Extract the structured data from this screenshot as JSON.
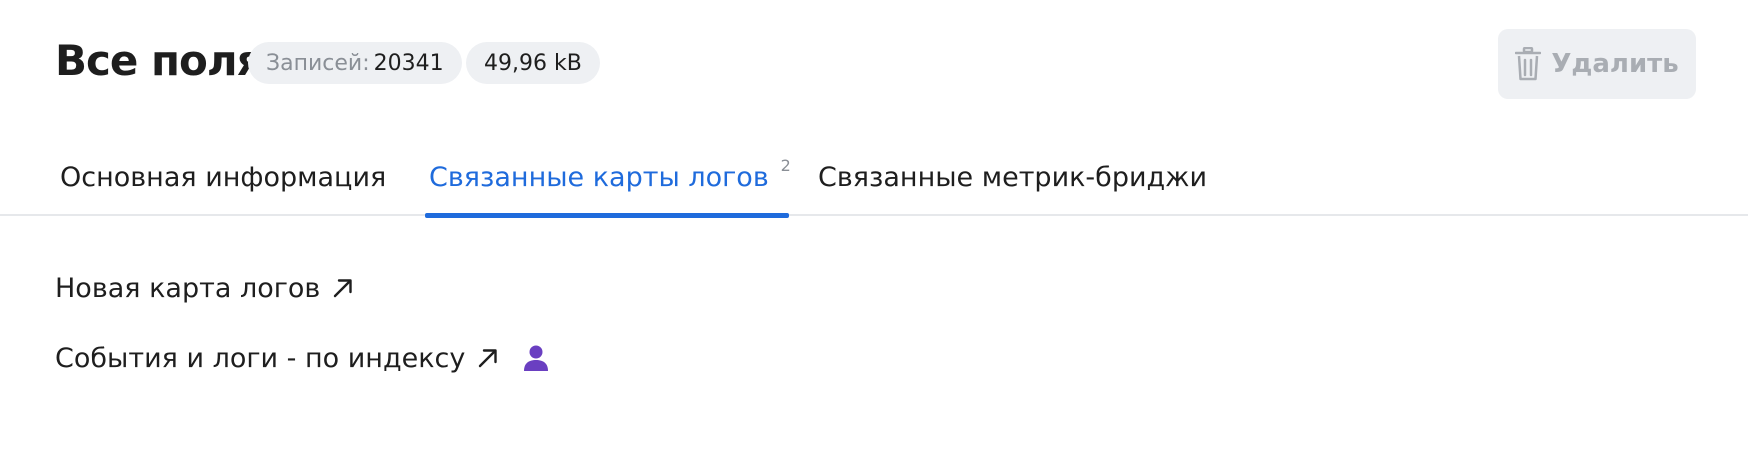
{
  "header": {
    "title": "Все поля",
    "records_label": "Записей:",
    "records_value": "20341",
    "size_value": "49,96 kB",
    "delete_label": "Удалить"
  },
  "tabs": [
    {
      "label": "Основная информация",
      "active": false
    },
    {
      "label": "Связанные карты логов",
      "active": true,
      "counter": "2"
    },
    {
      "label": "Связанные метрик-бриджи",
      "active": false
    }
  ],
  "links": [
    {
      "label": "Новая карта логов",
      "icon": "external-arrow-icon"
    },
    {
      "label": "События и логи - по индексу",
      "icon": "external-arrow-icon",
      "badge_icon": "person-icon"
    }
  ],
  "colors": {
    "accent": "#1f6bdc",
    "chip_bg": "#eef0f3",
    "muted_text": "#8a8f96",
    "disabled_text": "#a9adb3",
    "person_icon": "#6a3fc1"
  }
}
